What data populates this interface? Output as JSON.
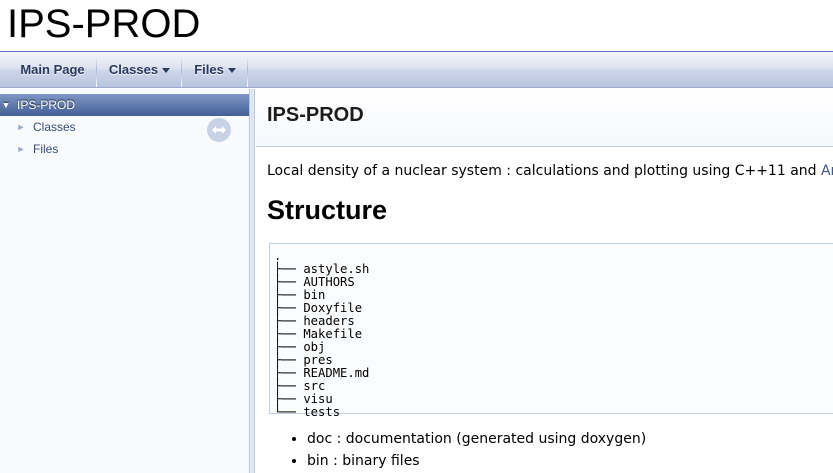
{
  "project": {
    "name": "IPS-PROD"
  },
  "navbar": {
    "tabs": [
      {
        "label": "Main Page"
      },
      {
        "label": "Classes"
      },
      {
        "label": "Files"
      }
    ]
  },
  "sidenav": {
    "items": [
      {
        "label": "IPS-PROD",
        "arrow": "▼"
      },
      {
        "label": "Classes",
        "arrow": "►"
      },
      {
        "label": "Files",
        "arrow": "►"
      }
    ]
  },
  "content": {
    "header_title": "IPS-PROD",
    "intro_text": "Local density of a nuclear system : calculations and plotting using C++11 and ",
    "intro_link": "Armadillo",
    "section_title": "Structure",
    "tree_lines": [
      ".",
      "├── astyle.sh",
      "├── AUTHORS",
      "├── bin",
      "├── Doxyfile",
      "├── headers",
      "├── Makefile",
      "├── obj",
      "├── pres",
      "├── README.md",
      "├── src",
      "├── visu",
      "└── tests"
    ],
    "bullets": [
      "doc : documentation (generated using doxygen)",
      "bin : binary files"
    ]
  }
}
